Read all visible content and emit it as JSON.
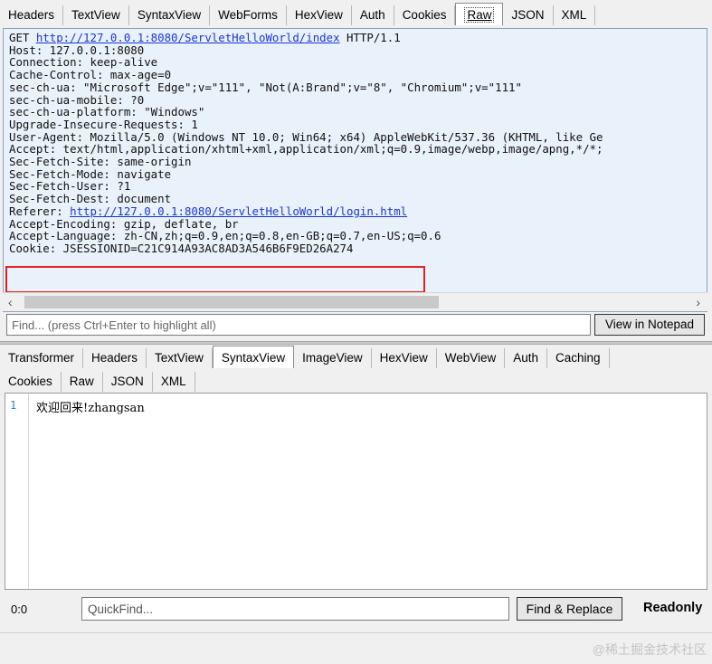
{
  "request_tabs": [
    "Headers",
    "TextView",
    "SyntaxView",
    "WebForms",
    "HexView",
    "Auth",
    "Cookies",
    "Raw",
    "JSON",
    "XML"
  ],
  "request_active_tab": "Raw",
  "request": {
    "line1_prefix": "GET ",
    "line1_url": "http://127.0.0.1:8080/ServletHelloWorld/index",
    "line1_suffix": " HTTP/1.1",
    "headers_a": [
      "Host: 127.0.0.1:8080",
      "Connection: keep-alive",
      "Cache-Control: max-age=0",
      "sec-ch-ua: \"Microsoft Edge\";v=\"111\", \"Not(A:Brand\";v=\"8\", \"Chromium\";v=\"111\"",
      "sec-ch-ua-mobile: ?0",
      "sec-ch-ua-platform: \"Windows\"",
      "Upgrade-Insecure-Requests: 1",
      "User-Agent: Mozilla/5.0 (Windows NT 10.0; Win64; x64) AppleWebKit/537.36 (KHTML, like Ge",
      "Accept: text/html,application/xhtml+xml,application/xml;q=0.9,image/webp,image/apng,*/*;",
      "Sec-Fetch-Site: same-origin",
      "Sec-Fetch-Mode: navigate",
      "Sec-Fetch-User: ?1",
      "Sec-Fetch-Dest: document"
    ],
    "referer_label": "Referer: ",
    "referer_url": "http://127.0.0.1:8080/ServletHelloWorld/login.html",
    "headers_b": [
      "Accept-Encoding: gzip, deflate, br",
      "Accept-Language: zh-CN,zh;q=0.9,en;q=0.8,en-GB;q=0.7,en-US;q=0.6",
      "Cookie: JSESSIONID=C21C914A93AC8AD3A546B6F9ED26A274"
    ]
  },
  "find": {
    "placeholder": "Find... (press Ctrl+Enter to highlight all)",
    "button": "View in Notepad"
  },
  "response_tabs_row1": [
    "Transformer",
    "Headers",
    "TextView",
    "SyntaxView",
    "ImageView",
    "HexView",
    "WebView",
    "Auth",
    "Caching"
  ],
  "response_tabs_row2": [
    "Cookies",
    "Raw",
    "JSON",
    "XML"
  ],
  "response_active_tab": "SyntaxView",
  "response": {
    "line_number": "1",
    "body": "欢迎回来!zhangsan"
  },
  "status": {
    "position": "0:0",
    "quickfind_placeholder": "QuickFind...",
    "find_replace": "Find & Replace",
    "readonly": "Readonly"
  },
  "watermark": "@稀土掘金技术社区",
  "colors": {
    "highlight_box": "#e0211f",
    "link": "#1a37d6",
    "request_bg": "#e9f1fb"
  }
}
